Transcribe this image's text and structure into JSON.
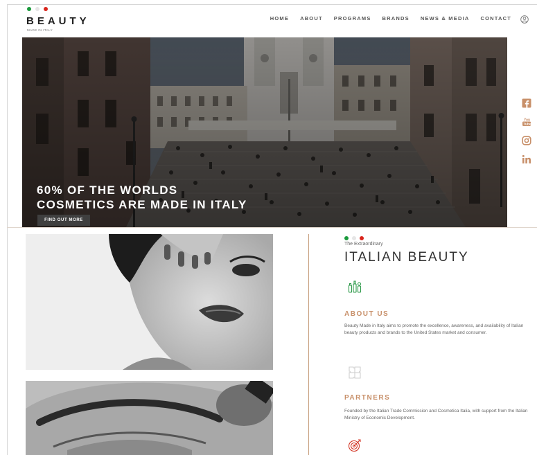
{
  "header": {
    "brand": "BEAUTY",
    "brand_sub": "MADE IN ITALY",
    "flag_colors": [
      "#1a9a3c",
      "#e6e6e6",
      "#d9251c"
    ],
    "nav": [
      "HOME",
      "ABOUT",
      "PROGRAMS",
      "BRANDS",
      "NEWS & MEDIA",
      "CONTACT"
    ],
    "user_icon": "user-icon"
  },
  "hero": {
    "title_line1": "60% OF THE WORLDS",
    "title_line2": "COSMETICS ARE MADE IN ITALY",
    "cta": "FIND OUT MORE"
  },
  "social": [
    "facebook-icon",
    "youtube-icon",
    "instagram-icon",
    "linkedin-icon"
  ],
  "intro": {
    "kicker": "The Extraordinary",
    "title": "ITALIAN BEAUTY"
  },
  "sections": [
    {
      "icon": "cosmetics-bottles-icon",
      "heading": "ABOUT US",
      "text": "Beauty Made in Italy aims to promote the excellence, awareness, and availability of Italian beauty products and brands to the United States market and consumer."
    },
    {
      "icon": "puzzle-icon",
      "heading": "PARTNERS",
      "text": "Founded by the Italian Trade Commission and Cosmetica Italia, with support from the Italian Ministry of Economic Development."
    },
    {
      "icon": "target-icon"
    }
  ],
  "colors": {
    "accent": "#c8906a",
    "green_icon": "#2e9a4a",
    "red_icon": "#d43a2a",
    "gray_icon": "#cfcfcf",
    "divider": "#c79f7e"
  }
}
